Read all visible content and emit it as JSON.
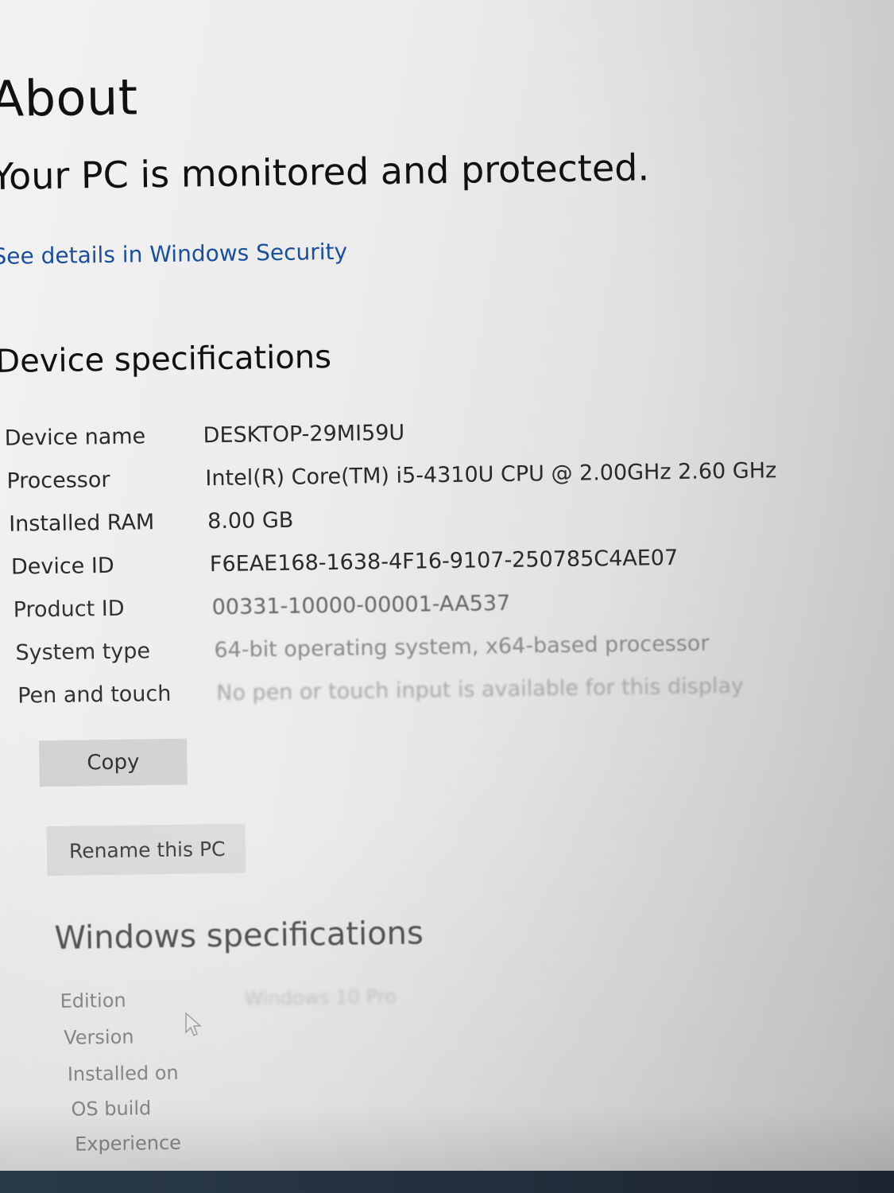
{
  "page": {
    "title": "About",
    "status_heading": "Your PC is monitored and protected.",
    "security_link": "See details in Windows Security"
  },
  "device_specs": {
    "heading": "Device specifications",
    "rows": [
      {
        "label": "Device name",
        "value": "DESKTOP-29MI59U"
      },
      {
        "label": "Processor",
        "value": "Intel(R) Core(TM) i5-4310U CPU @ 2.00GHz   2.60 GHz"
      },
      {
        "label": "Installed RAM",
        "value": "8.00 GB"
      },
      {
        "label": "Device ID",
        "value": "F6EAE168-1638-4F16-9107-250785C4AE07"
      },
      {
        "label": "Product ID",
        "value": "00331-10000-00001-AA537"
      },
      {
        "label": "System type",
        "value": "64-bit operating system, x64-based processor"
      },
      {
        "label": "Pen and touch",
        "value": "No pen or touch input is available for this display"
      }
    ],
    "copy_button": "Copy",
    "rename_button": "Rename this PC"
  },
  "windows_specs": {
    "heading": "Windows specifications",
    "rows": [
      {
        "label": "Edition",
        "value": "Windows 10 Pro"
      },
      {
        "label": "Version",
        "value": ""
      },
      {
        "label": "Installed on",
        "value": ""
      },
      {
        "label": "OS build",
        "value": ""
      },
      {
        "label": "Experience",
        "value": ""
      }
    ]
  },
  "colors": {
    "link": "#1a4f9c",
    "text": "#111111",
    "button_bg": "#d3d3d3",
    "taskbar": "#1c2530"
  }
}
